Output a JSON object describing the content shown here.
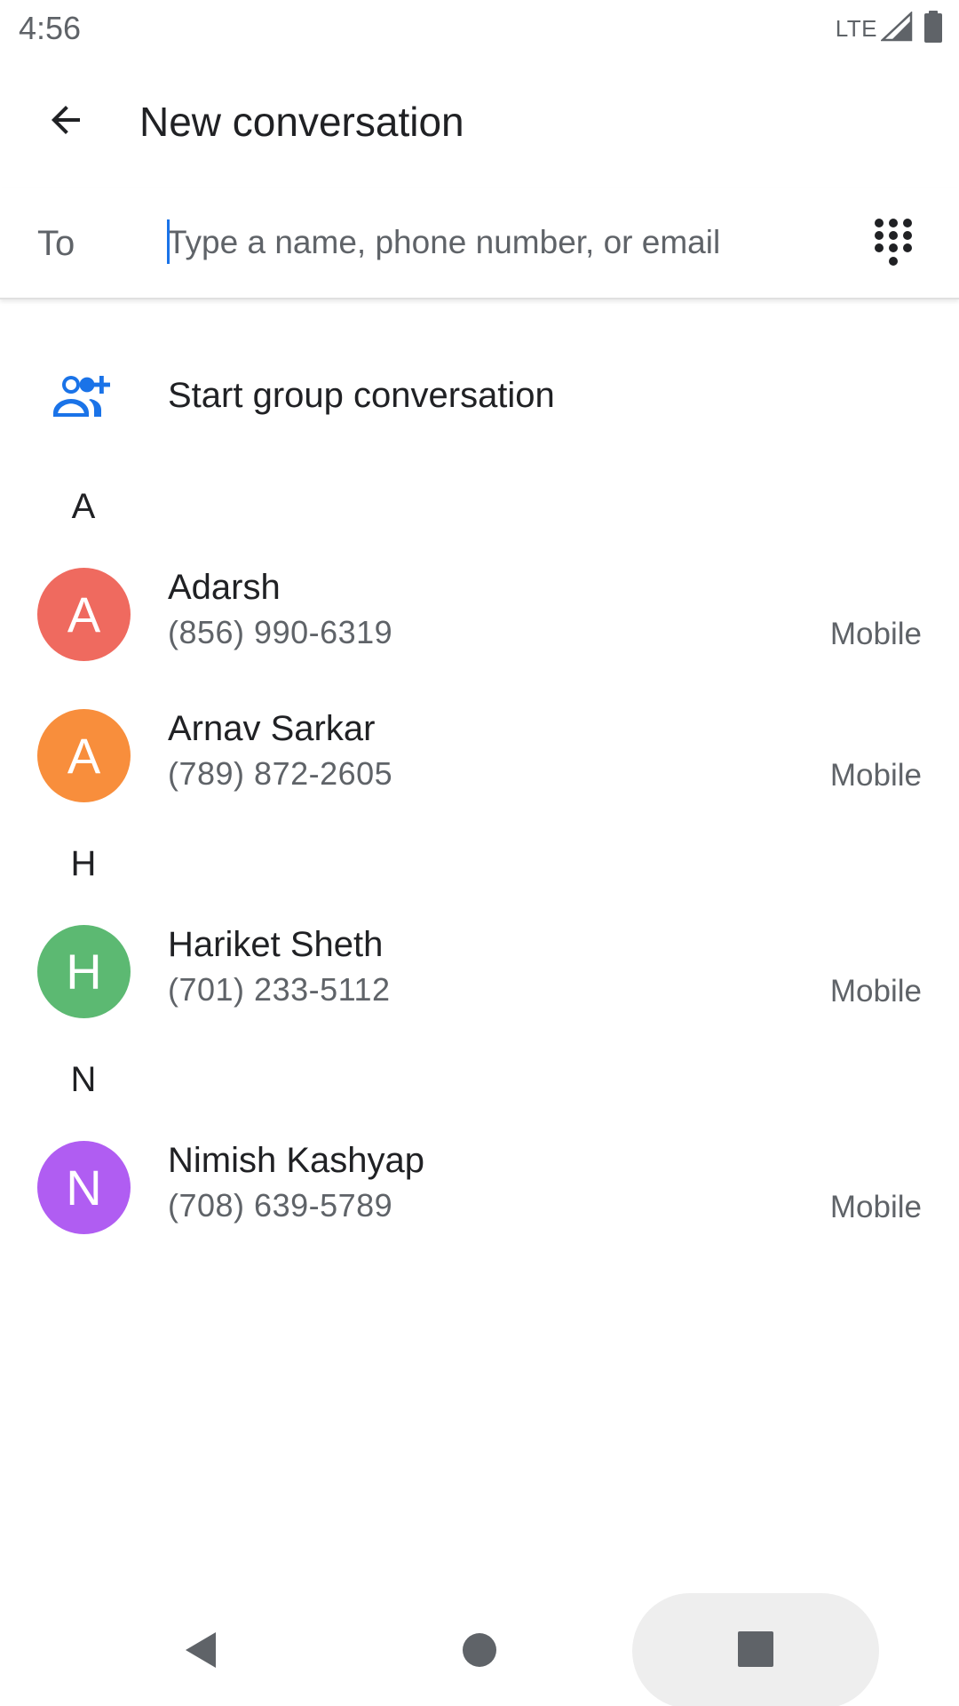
{
  "status_bar": {
    "time": "4:56",
    "network": "LTE",
    "icons": [
      "signal-icon",
      "battery-icon"
    ]
  },
  "app_bar": {
    "back_icon": "arrow-back-icon",
    "title": "New conversation"
  },
  "recipient": {
    "label": "To",
    "value": "",
    "placeholder": "Type a name, phone number, or email",
    "dialpad_icon": "dialpad-icon"
  },
  "group": {
    "icon": "group-add-icon",
    "label": "Start group conversation"
  },
  "sections": [
    {
      "header": "A",
      "contacts": [
        {
          "initial": "A",
          "name": "Adarsh",
          "phone": "(856) 990-6319",
          "type": "Mobile",
          "color": "#ef6a5f"
        },
        {
          "initial": "A",
          "name": "Arnav Sarkar",
          "phone": "(789) 872-2605",
          "type": "Mobile",
          "color": "#f88e3c"
        }
      ]
    },
    {
      "header": "H",
      "contacts": [
        {
          "initial": "H",
          "name": "Hariket Sheth",
          "phone": "(701) 233-5112",
          "type": "Mobile",
          "color": "#5cb972"
        }
      ]
    },
    {
      "header": "N",
      "contacts": [
        {
          "initial": "N",
          "name": "Nimish Kashyap",
          "phone": "(708) 639-5789",
          "type": "Mobile",
          "color": "#b05df2"
        }
      ]
    }
  ],
  "colors": {
    "accent": "#1a73e8",
    "text_primary": "#202124",
    "text_secondary": "#5f6368"
  },
  "nav_bar": {
    "icons": [
      "nav-back-icon",
      "nav-home-icon",
      "nav-recents-icon"
    ]
  }
}
